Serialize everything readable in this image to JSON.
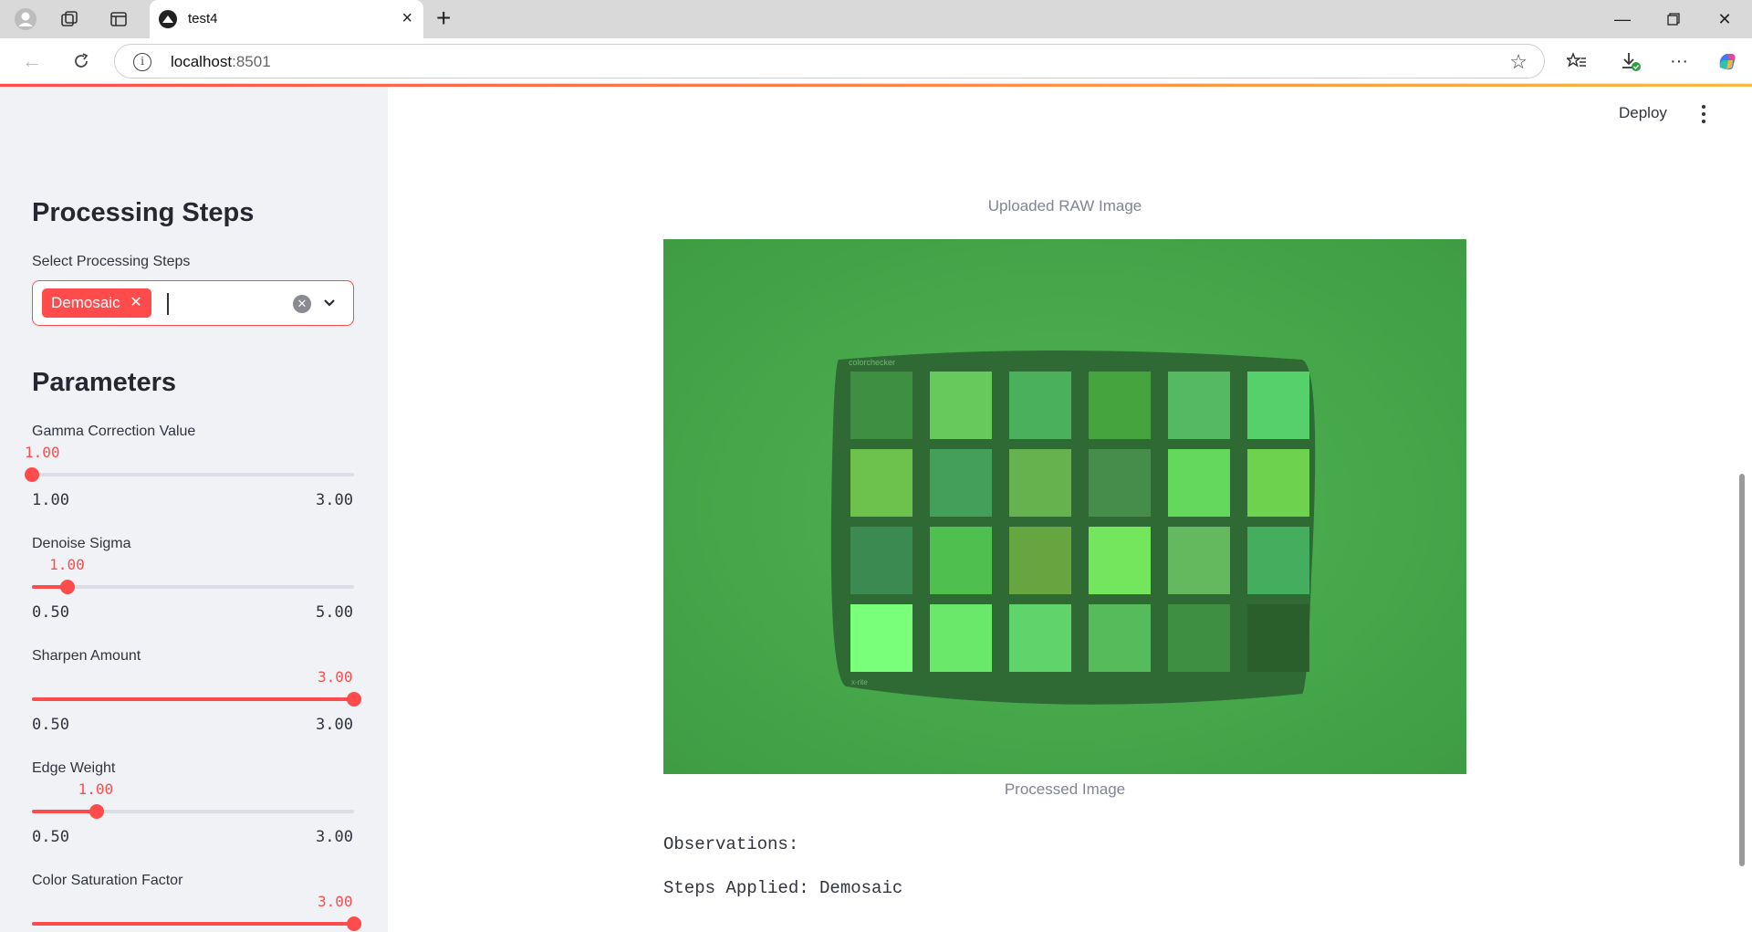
{
  "browser": {
    "tab_title": "test4",
    "url_host": "localhost",
    "url_port": ":8501"
  },
  "sidebar": {
    "processing_heading": "Processing Steps",
    "select_label": "Select Processing Steps",
    "selected_chip": "Demosaic",
    "parameters_heading": "Parameters",
    "sliders": [
      {
        "label": "Gamma Correction Value",
        "value_text": "1.00",
        "min_text": "1.00",
        "max_text": "3.00",
        "fraction": 0.0
      },
      {
        "label": "Denoise Sigma",
        "value_text": "1.00",
        "min_text": "0.50",
        "max_text": "5.00",
        "fraction": 0.111
      },
      {
        "label": "Sharpen Amount",
        "value_text": "3.00",
        "min_text": "0.50",
        "max_text": "3.00",
        "fraction": 1.0
      },
      {
        "label": "Edge Weight",
        "value_text": "1.00",
        "min_text": "0.50",
        "max_text": "3.00",
        "fraction": 0.2
      },
      {
        "label": "Color Saturation Factor",
        "value_text": "3.00",
        "min_text": "",
        "max_text": "",
        "fraction": 1.0
      }
    ]
  },
  "header": {
    "deploy_label": "Deploy"
  },
  "main": {
    "uploaded_caption": "Uploaded RAW Image",
    "processed_caption": "Processed Image",
    "observations": "Observations:",
    "steps_applied": "Steps Applied: Demosaic"
  },
  "colors": {
    "accent": "#ff4b4b",
    "image_bg": "#4caf50"
  }
}
